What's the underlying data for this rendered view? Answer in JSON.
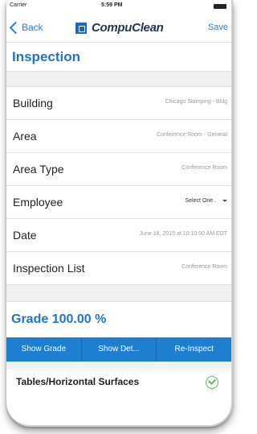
{
  "status": {
    "carrier": "Carrier",
    "time": "5:59 PM"
  },
  "nav": {
    "back_label": "Back",
    "logo_text": "CompuClean",
    "save_label": "Save"
  },
  "page_title": "Inspection",
  "fields": [
    {
      "label": "Building",
      "value": "Chicago Stamping - Bldg"
    },
    {
      "label": "Area",
      "value": "Conference Room - General"
    },
    {
      "label": "Area Type",
      "value": "Conference Room"
    },
    {
      "label": "Employee",
      "value": "Select One ."
    },
    {
      "label": "Date",
      "value": "June 18, 2015 at 10:10:00 AM EDT"
    },
    {
      "label": "Inspection List",
      "value": "Conference Room"
    }
  ],
  "grade": "Grade 100.00 %",
  "actions": {
    "show_grade": "Show Grade",
    "show_details": "Show Det...",
    "reinspect": "Re-Inspect"
  },
  "section": {
    "title": "Tables/Horizontal Surfaces"
  },
  "colors": {
    "accent": "#1e7fd0",
    "title": "#1f76c9"
  }
}
